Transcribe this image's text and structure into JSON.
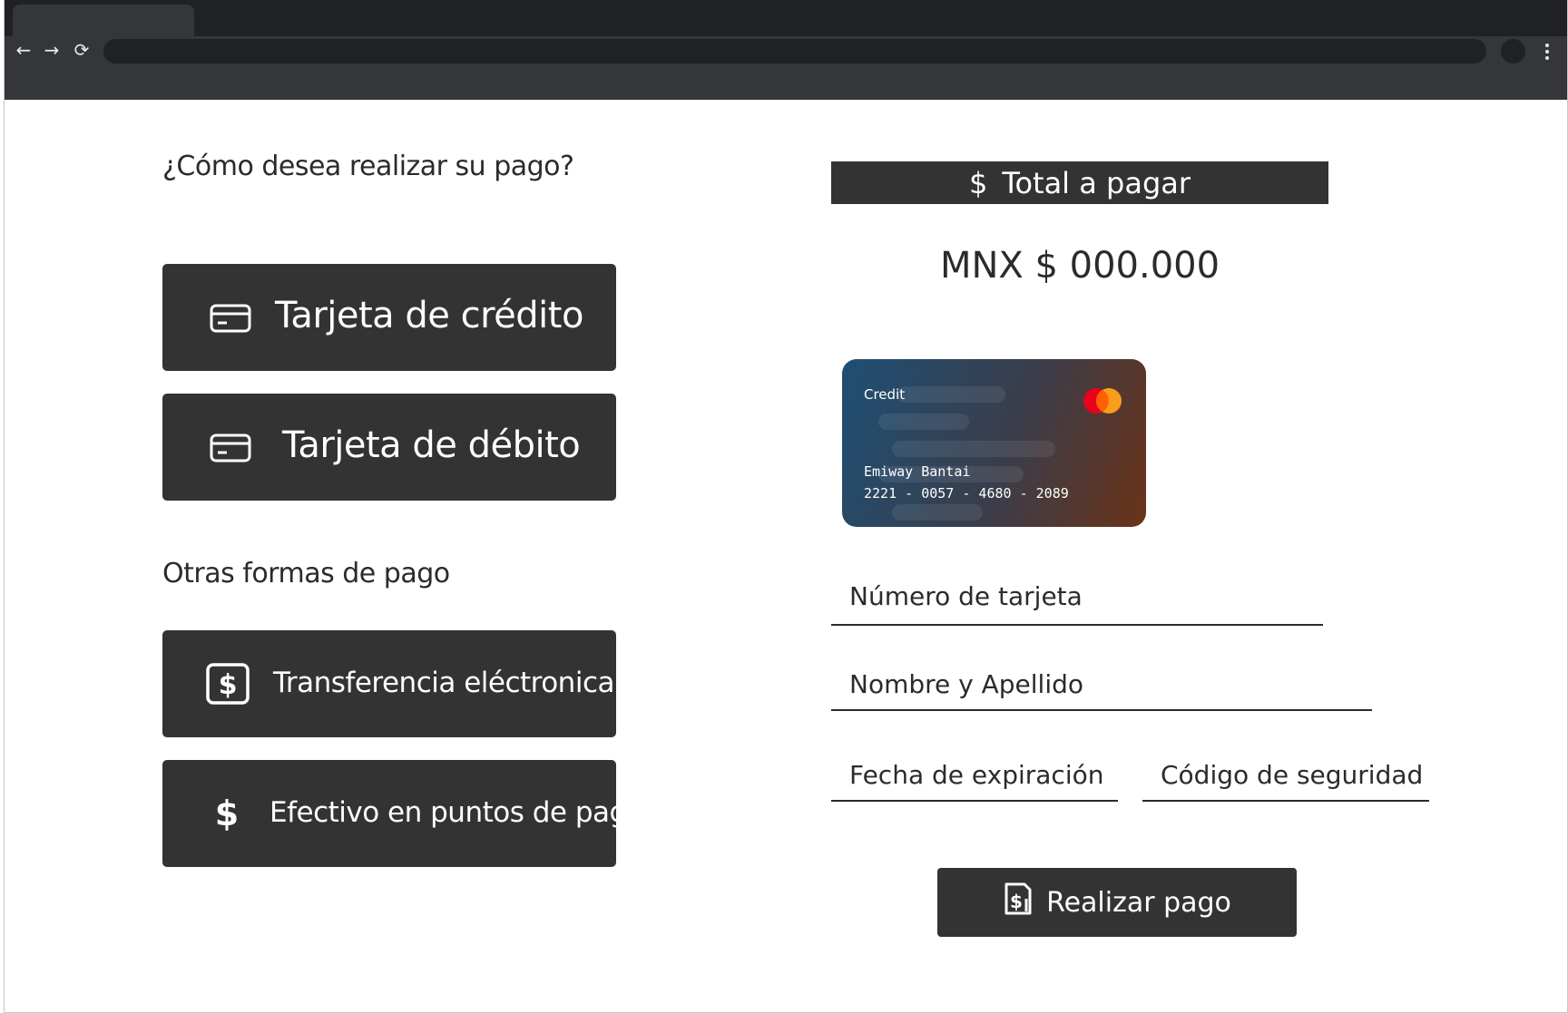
{
  "browser": {
    "nav": {
      "back": "←",
      "forward": "→",
      "reload": "⟳"
    }
  },
  "payment_methods": {
    "question": "¿Cómo desea realizar su pago?",
    "credit_label": "Tarjeta de crédito",
    "debit_label": "Tarjeta de débito",
    "other_title": "Otras formas de pago",
    "transfer_label": "Transferencia eléctronica",
    "cash_label": "Efectivo en puntos de pago",
    "icons": {
      "credit": "credit-card-icon",
      "debit": "credit-card-icon",
      "transfer": "dollar-square-icon",
      "cash": "dollar-icon"
    }
  },
  "total": {
    "title": "Total a pagar",
    "icon": "dollar-icon",
    "amount": "MNX $ 000.000"
  },
  "card_preview": {
    "type": "Credit",
    "holder": "Emiway Bantai",
    "number": "2221 - 0057 - 4680 - 2089",
    "brand_icon": "mastercard-logo"
  },
  "form": {
    "card_number_placeholder": "Número de tarjeta",
    "name_placeholder": "Nombre y Apellido",
    "expiry_placeholder": "Fecha de expiración",
    "cvv_placeholder": "Código de seguridad",
    "submit_label": "Realizar pago",
    "submit_icon": "receipt-dollar-icon"
  },
  "colors": {
    "button_bg": "#333333",
    "text": "#2b2b2b",
    "chrome_dark": "#202124",
    "chrome_toolbar": "#35363a"
  }
}
